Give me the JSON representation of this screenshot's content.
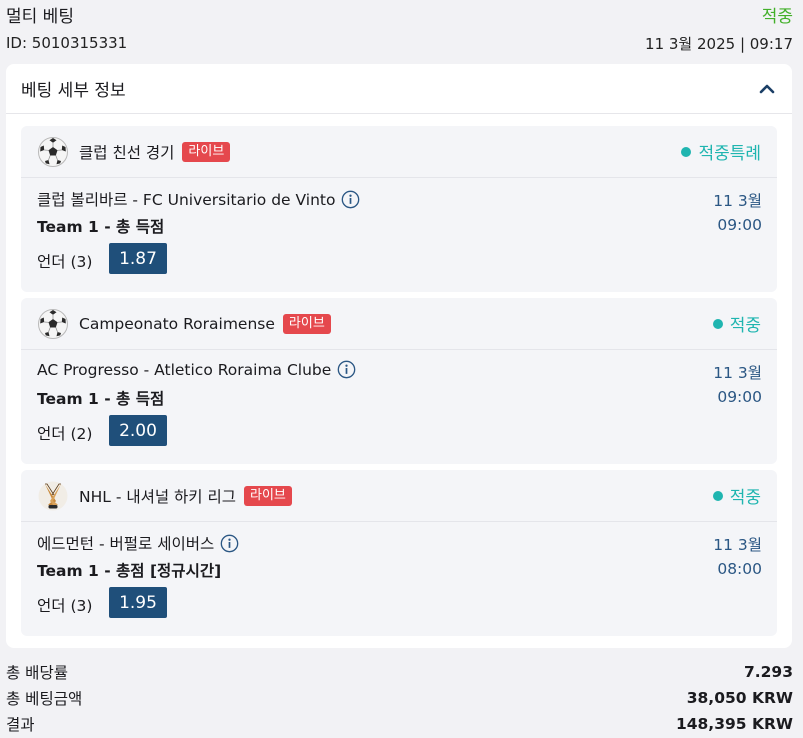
{
  "header": {
    "title": "멀티 베팅",
    "status": "적중",
    "id_label": "ID: 5010315331",
    "datetime": "11 3월 2025 | 09:17"
  },
  "details": {
    "title": "베팅 세부 정보",
    "collapse_icon": "chevron-up-icon"
  },
  "events": [
    {
      "sport_icon": "soccer-ball-icon",
      "league": "클럽 친선 경기",
      "live_label": "라이브",
      "status": "적중특례",
      "match": "클럽 볼리바르 - FC Universitario de Vinto",
      "date": "11 3월",
      "time": "09:00",
      "market": "Team 1 - 총 득점",
      "selection": "언더 (3)",
      "odds": "1.87"
    },
    {
      "sport_icon": "soccer-ball-icon",
      "league": "Campeonato Roraimense",
      "live_label": "라이브",
      "status": "적중",
      "match": "AC Progresso - Atletico Roraima Clube",
      "date": "11 3월",
      "time": "09:00",
      "market": "Team 1 - 총 득점",
      "selection": "언더 (2)",
      "odds": "2.00"
    },
    {
      "sport_icon": "hockey-sticks-icon",
      "league": "NHL - 내셔널 하키 리그",
      "live_label": "라이브",
      "status": "적중",
      "match": "에드먼턴 - 버펄로 세이버스",
      "date": "11 3월",
      "time": "08:00",
      "market": "Team 1 - 총점 [정규시간]",
      "selection": "언더 (3)",
      "odds": "1.95"
    }
  ],
  "summary": {
    "total_odds_label": "총 배당률",
    "total_odds_value": "7.293",
    "stake_label": "총 베팅금액",
    "stake_value": "38,050 KRW",
    "result_label": "결과",
    "result_value": "148,395 KRW"
  },
  "colors": {
    "won_green": "#43b02a",
    "status_teal": "#1fb5b0",
    "live_red": "#e5484d",
    "odds_navy": "#1f4f7a",
    "date_blue": "#2b5784"
  }
}
